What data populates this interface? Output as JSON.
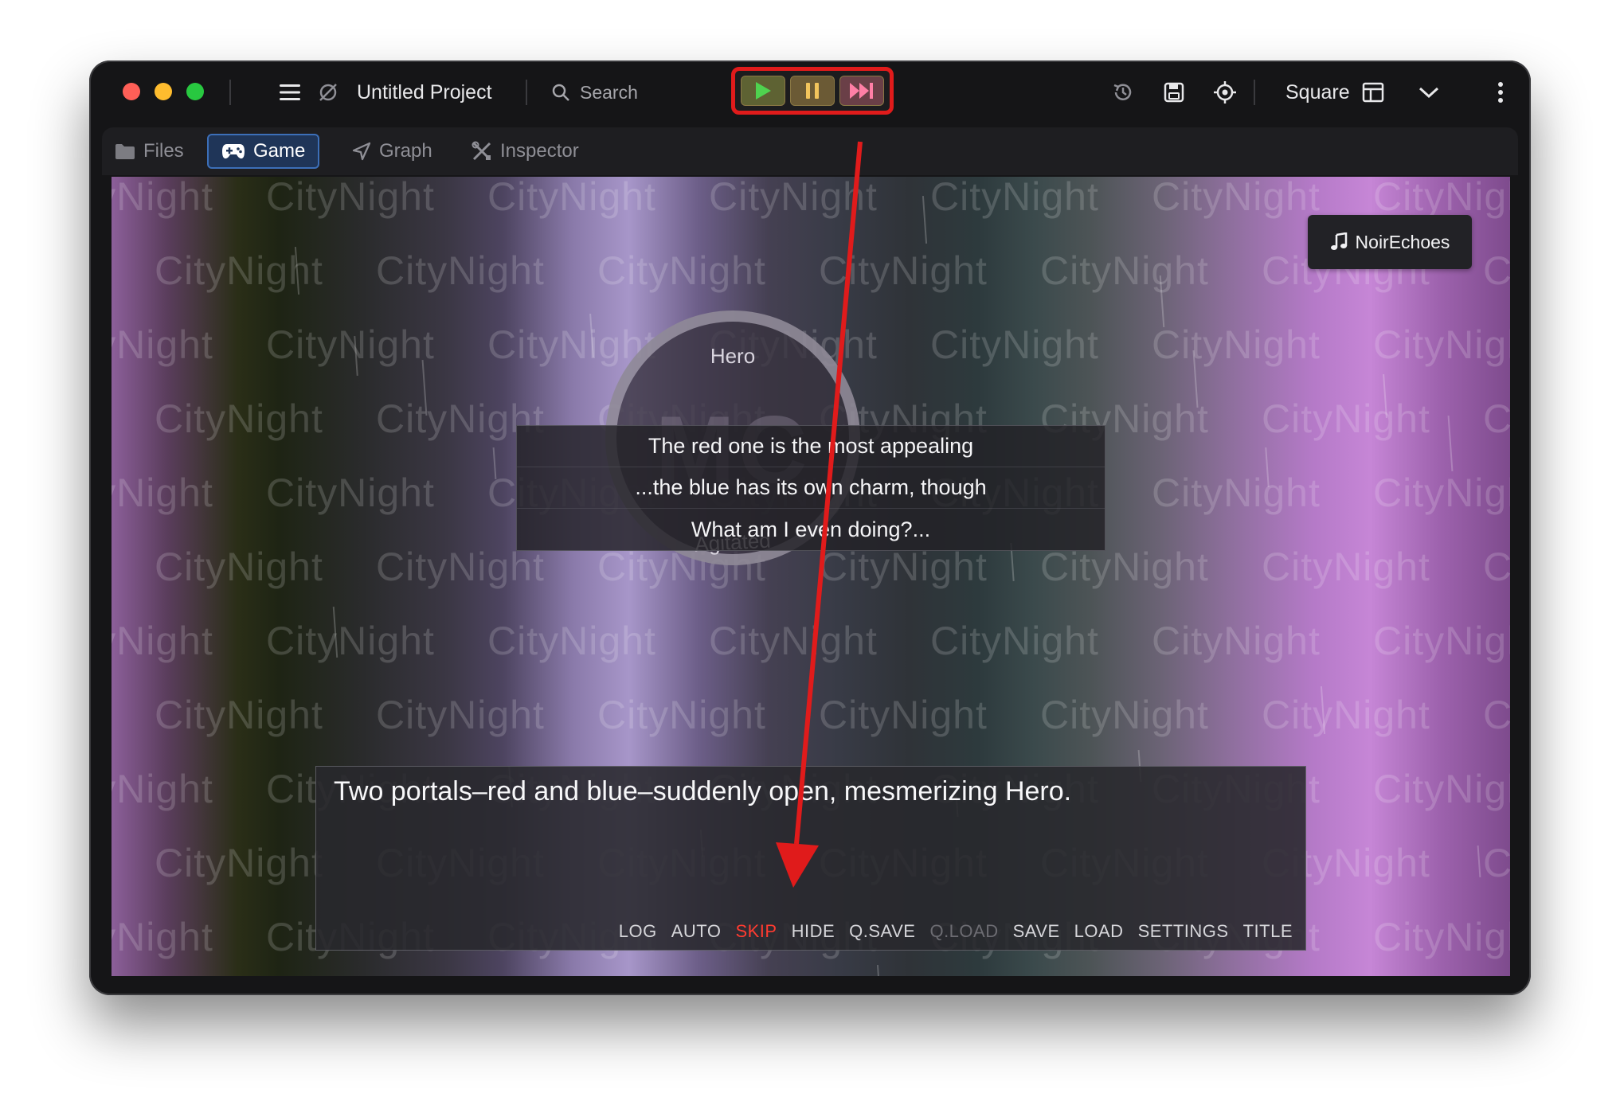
{
  "window": {
    "project_title": "Untitled Project",
    "search_placeholder": "Search",
    "layout_label": "Square"
  },
  "tabs": [
    {
      "label": "Files",
      "active": false
    },
    {
      "label": "Game",
      "active": true
    },
    {
      "label": "Graph",
      "active": false
    },
    {
      "label": "Inspector",
      "active": false
    }
  ],
  "game": {
    "watermark_text": "CityNight",
    "music_track": "NoirEchoes",
    "portrait": {
      "initials": "MC",
      "name": "Hero",
      "mood": "Agitated"
    },
    "choices": [
      "The red one is the most appealing",
      "...the blue has its own charm, though",
      "What am I even doing?..."
    ],
    "dialog_text": "Two portals–red and blue–suddenly open, mesmerizing Hero.",
    "menu": {
      "log": "LOG",
      "auto": "AUTO",
      "skip": "SKIP",
      "hide": "HIDE",
      "qsave": "Q.SAVE",
      "qload": "Q.LOAD",
      "save": "SAVE",
      "load": "LOAD",
      "settings": "SETTINGS",
      "title": "TITLE"
    }
  },
  "colors": {
    "annotation_red": "#e01b1b",
    "active_tab": "#1f3558",
    "skip_active": "#ff3b30"
  },
  "icons": [
    "menu-icon",
    "hide-eye-slash-icon",
    "search-icon",
    "play-icon",
    "pause-icon",
    "fast-forward-icon",
    "history-icon",
    "save-icon",
    "target-icon",
    "layout-icon",
    "chevron-down-icon",
    "more-vertical-icon",
    "folder-icon",
    "gamepad-icon",
    "graph-icon",
    "tools-icon",
    "music-note-icon"
  ]
}
